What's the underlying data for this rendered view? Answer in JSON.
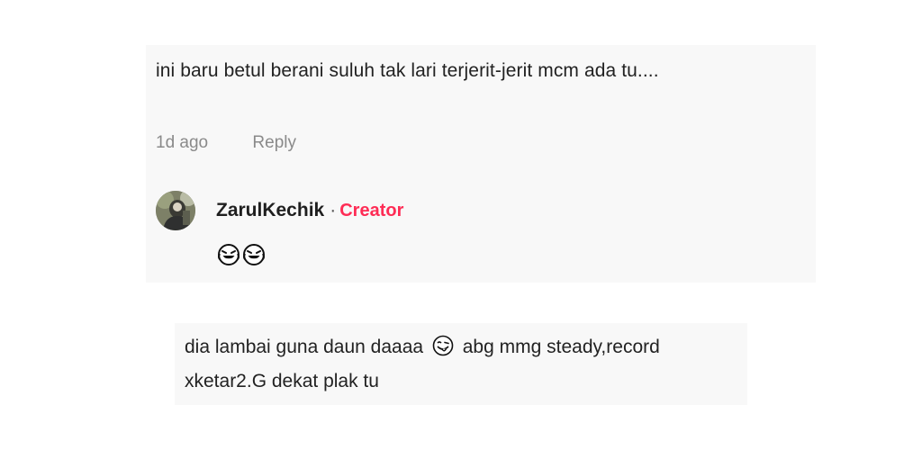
{
  "comments": [
    {
      "text": "ini baru betul berani suluh tak lari terjerit-jerit mcm ada tu....",
      "time": "1d ago",
      "reply_label": "Reply",
      "reply": {
        "author": "ZarulKechik",
        "separator": "·",
        "badge": "Creator",
        "badge_color": "#fe2c55",
        "emojis": [
          "laughing-tears-emoji-icon",
          "laughing-tears-emoji-icon"
        ]
      }
    },
    {
      "text_before_emoji": "dia lambai guna daun daaaa",
      "inline_emoji": "winking-tongue-emoji-icon",
      "text_after_emoji": "abg mmg steady,record xketar2.G dekat plak tu"
    }
  ],
  "colors": {
    "card_background": "#f8f8f8",
    "text": "#222222",
    "muted": "#8a8a8a",
    "accent": "#fe2c55"
  }
}
